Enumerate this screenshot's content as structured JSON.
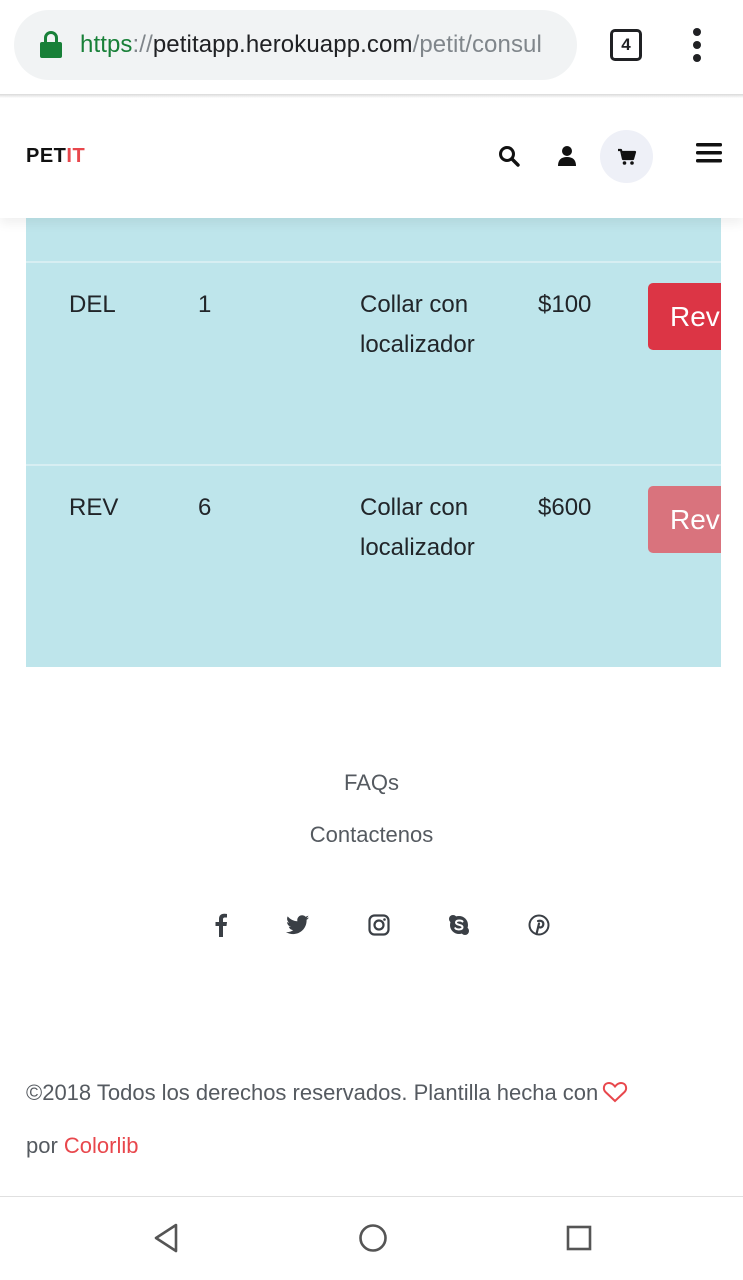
{
  "browser": {
    "url_scheme": "https",
    "url_separator": "://",
    "url_host": "petitapp.herokuapp.com",
    "url_path": "/petit/consul",
    "tab_count": "4",
    "secure_color": "#188038"
  },
  "header": {
    "logo_part1": "PET",
    "logo_part2": "IT",
    "accent_color": "#e8474c",
    "icons": [
      "search-icon",
      "user-icon",
      "cart-icon",
      "menu-icon"
    ]
  },
  "table": {
    "background": "#bee5eb",
    "rows": [
      {
        "code": "DEL",
        "quantity": "1",
        "product": "Collar con localizador",
        "price": "$100",
        "action": "Rev",
        "action_state": "active"
      },
      {
        "code": "REV",
        "quantity": "6",
        "product": "Collar con localizador",
        "price": "$600",
        "action": "Rev",
        "action_state": "disabled"
      }
    ]
  },
  "footer": {
    "links": [
      "FAQs",
      "Contactenos"
    ],
    "social_icons": [
      "facebook-icon",
      "twitter-icon",
      "instagram-icon",
      "skype-icon",
      "pinterest-icon"
    ],
    "copyright_text": "©2018 Todos los derechos reservados. Plantilla hecha con",
    "by_text": "por",
    "brand": "Colorlib"
  },
  "system_nav": {
    "buttons": [
      "back-icon",
      "home-icon",
      "recents-icon"
    ]
  }
}
